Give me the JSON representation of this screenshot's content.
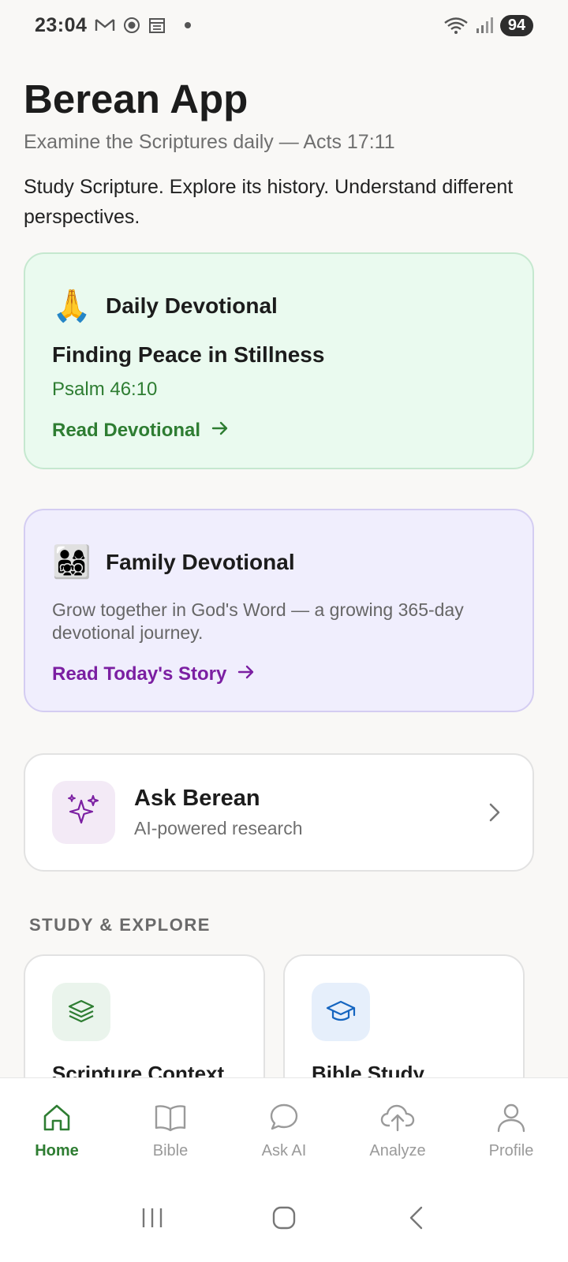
{
  "status_bar": {
    "time": "23:04",
    "battery": "94",
    "icons": [
      "gmail-icon",
      "record-icon",
      "calendar-icon",
      "notification-dot",
      "wifi-icon",
      "signal-icon"
    ]
  },
  "header": {
    "title": "Berean App",
    "tagline": "Examine the Scriptures daily — Acts 17:11",
    "intro": "Study Scripture. Explore its history. Understand different perspectives."
  },
  "daily_devotional": {
    "emoji": "🙏",
    "heading": "Daily Devotional",
    "title": "Finding Peace in Stillness",
    "reference": "Psalm 46:10",
    "link": "Read Devotional",
    "accent_color": "#2e7d32"
  },
  "family_devotional": {
    "emoji": "👨‍👩‍👧‍👦",
    "heading": "Family Devotional",
    "description": "Grow together in God's Word — a growing 365-day devotional journey.",
    "link": "Read Today's Story",
    "accent_color": "#7b1fa2"
  },
  "ask_berean": {
    "title": "Ask Berean",
    "subtitle": "AI-powered research",
    "icon": "sparkles-icon"
  },
  "study_section": {
    "label": "STUDY & EXPLORE",
    "tiles": [
      {
        "title": "Scripture Context",
        "icon": "layers-icon"
      },
      {
        "title": "Bible Study",
        "icon": "graduation-cap-icon"
      }
    ]
  },
  "bottom_nav": {
    "items": [
      {
        "label": "Home",
        "icon": "home-icon",
        "active": true
      },
      {
        "label": "Bible",
        "icon": "book-icon",
        "active": false
      },
      {
        "label": "Ask AI",
        "icon": "chat-icon",
        "active": false
      },
      {
        "label": "Analyze",
        "icon": "cloud-upload-icon",
        "active": false
      },
      {
        "label": "Profile",
        "icon": "user-icon",
        "active": false
      }
    ],
    "active_color": "#2e7d32"
  },
  "system_nav": {
    "buttons": [
      "recent-apps-icon",
      "home-button-icon",
      "back-icon"
    ]
  }
}
